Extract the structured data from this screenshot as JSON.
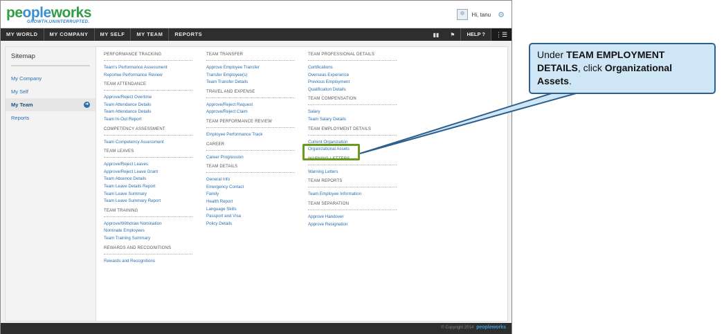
{
  "header": {
    "logo_text_a": "pe",
    "logo_text_b": "ople",
    "logo_text_c": "works",
    "logo_tagline": "GROWTH.UNINTERRUPTED.",
    "greeting": "Hi, tanu"
  },
  "nav": {
    "items": [
      "MY WORLD",
      "MY COMPANY",
      "MY SELF",
      "MY TEAM",
      "REPORTS"
    ],
    "help_label": "HELP"
  },
  "sidebar": {
    "title": "Sitemap",
    "items": [
      {
        "label": "My Company"
      },
      {
        "label": "My Self"
      },
      {
        "label": "My Team",
        "active": true
      },
      {
        "label": "Reports"
      }
    ]
  },
  "columns": [
    {
      "sections": [
        {
          "title": "PERFORMANCE TRACKING",
          "links": [
            "Team's Performance Assessment",
            "Reportee Performance Review"
          ]
        },
        {
          "title": "TEAM ATTENDANCE",
          "links": [
            "Approve/Reject Overtime",
            "Team Attendance Details",
            "Team Attendance Details",
            "Team In-Out Report"
          ]
        },
        {
          "title": "COMPETENCY ASSESSMENT",
          "links": [
            "Team Competency Assessment"
          ]
        },
        {
          "title": "TEAM LEAVES",
          "links": [
            "Approve/Reject Leaves",
            "Approve/Reject Leave Grant",
            "Team Absence Details",
            "Team Leave Details Report",
            "Team Leave Summary",
            "Team Leave Summary Report"
          ]
        },
        {
          "title": "TEAM TRAINING",
          "links": [
            "Approve/Withdraw Nomination",
            "Nominate Employees",
            "Team Training Summary"
          ]
        },
        {
          "title": "REWARDS AND RECOGNITIONS",
          "links": [
            "Rewards and Recognitions"
          ]
        }
      ]
    },
    {
      "sections": [
        {
          "title": "TEAM TRANSFER",
          "links": [
            "Approve Employee Transfer",
            "Transfer Employee(s)",
            "Team Transfer Details"
          ]
        },
        {
          "title": "TRAVEL AND EXPENSE",
          "links": [
            "Approve/Reject Request",
            "Approve/Reject Claim"
          ]
        },
        {
          "title": "TEAM PERFORMANCE REVIEW",
          "links": [
            "Employee Performance Track"
          ]
        },
        {
          "title": "CAREER",
          "links": [
            "Career Progression"
          ]
        },
        {
          "title": "TEAM DETAILS",
          "links": [
            "General Info",
            "Emergency Contact",
            "Family",
            "Health Report",
            "Language Skills",
            "Passport and Visa",
            "Policy Details"
          ]
        }
      ]
    },
    {
      "sections": [
        {
          "title": "TEAM PROFESSIONAL DETAILS",
          "links": [
            "Certifications",
            "Overseas Experience",
            "Previous Employment",
            "Qualification Details"
          ]
        },
        {
          "title": "TEAM COMPENSATION",
          "links": [
            "Salary",
            "Team Salary Details"
          ]
        },
        {
          "title": "TEAM EMPLOYMENT DETAILS",
          "links": [
            "Current Organization",
            "Organizational Assets"
          ]
        },
        {
          "title": "WARNING LETTERS",
          "links": [
            "Warning Letters"
          ]
        },
        {
          "title": "TEAM REPORTS",
          "links": [
            "Team Employee Information"
          ]
        },
        {
          "title": "TEAM SEPARATION",
          "links": [
            "Approve Handover",
            "Approve Resignation"
          ]
        }
      ]
    }
  ],
  "footer": {
    "copyright": "© Copyright 2014",
    "brand": "peopleworks"
  },
  "callout": {
    "prefix": "Under ",
    "bold1": "TEAM EMPLOYMENT DETAILS",
    "mid": ", click ",
    "bold2": "Organizational Assets",
    "suffix": "."
  },
  "colors": {
    "nav_bg": "#2e2e2e",
    "link": "#2a6fb0",
    "highlight": "#6a9a1f",
    "callout_bg": "#cfe6f7",
    "callout_border": "#2d5f8e"
  }
}
